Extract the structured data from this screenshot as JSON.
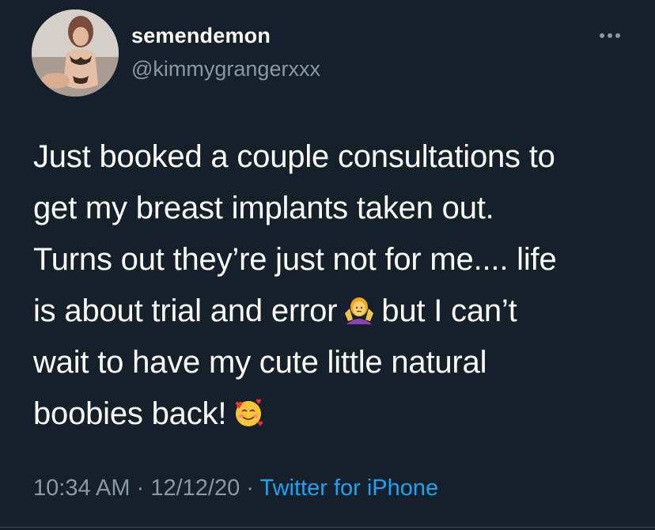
{
  "tweet": {
    "display_name": "semendemon",
    "handle": "@kimmygrangerxxx",
    "more_icon": "more-horizontal-icon",
    "text_lines": {
      "l1": "Just booked a couple consultations to",
      "l2": "get my breast implants taken out.",
      "l3": "Turns out they’re just not for me.... life",
      "l4a": "is about trial and error",
      "l4b": "but I can’t",
      "l5": "wait to have my cute little natural",
      "l6": "boobies back!"
    },
    "emojis": {
      "shrug": "person-shrugging-emoji",
      "smiling_hearts": "smiling-face-with-hearts-emoji"
    },
    "time": "10:34 AM",
    "separator": "·",
    "date": "12/12/20",
    "source": "Twitter for iPhone"
  },
  "colors": {
    "background": "#15202b",
    "secondary_text": "#8899a6",
    "link": "#1da1f2"
  }
}
